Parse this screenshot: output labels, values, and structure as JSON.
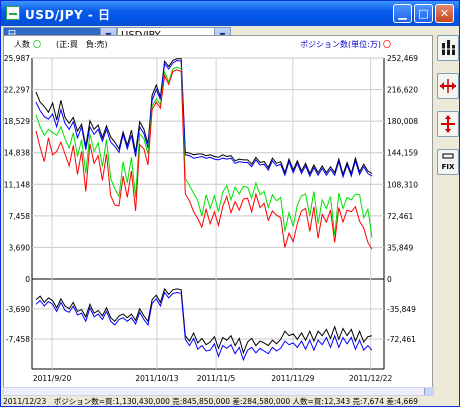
{
  "window": {
    "title": "USD/JPY - 日"
  },
  "toolbar": {
    "left_combo_value": "日",
    "right_combo_value": "USD/JPY"
  },
  "legend": {
    "left_label": "人数",
    "left_marker": "〇",
    "sign_note": "(正:買　負:売)",
    "right_label": "ポジション数(単位:万)",
    "right_marker": "〇"
  },
  "colors": {
    "position_buy": "#000080",
    "position_sell": "#0000ff",
    "people_buy": "#00e000",
    "people_sell": "#ff0000",
    "black_series": "#000000"
  },
  "chart_data": [
    {
      "type": "line",
      "panel": "upper",
      "left_axis_ticks": [
        "25,987",
        "22,297",
        "18,529",
        "14,838",
        "11,148",
        "7,458",
        "3,690",
        "0"
      ],
      "right_axis_ticks": [
        "252,469",
        "216,620",
        "180,008",
        "144,159",
        "108,310",
        "72,461",
        "35,849",
        "0"
      ],
      "left_ylim": [
        0,
        25987
      ],
      "right_ylim": [
        0,
        252469
      ],
      "x_tick_labels": [
        "2011/9/20",
        "2011/10/13",
        "2011/11/5",
        "2011/11/29",
        "2011/12/22"
      ],
      "series": [
        {
          "color_key": "black_series",
          "axis": "left",
          "values": [
            22000,
            20800,
            20300,
            19600,
            20700,
            18700,
            21000,
            19000,
            18300,
            19000,
            17400,
            18200,
            15600,
            18600,
            17600,
            18100,
            16600,
            18000,
            16700,
            16100,
            15300,
            17300,
            15700,
            17500,
            14900,
            18500,
            17600,
            15900,
            21600,
            22800,
            21400,
            25600,
            25000,
            25700,
            25900,
            25900,
            14900,
            14800,
            14600,
            14700,
            14700,
            14500,
            14600,
            14400,
            14300,
            14600,
            14400,
            14500,
            13900,
            14100,
            14000,
            14000,
            13500,
            14300,
            13700,
            13800,
            13100,
            14200,
            13600,
            13800,
            12500,
            14100,
            12800,
            13900,
            12700,
            13600,
            12400,
            13400,
            12500,
            13300,
            12500,
            13200,
            12500,
            14100,
            12300,
            13700,
            12400,
            14200,
            12600,
            13500,
            12700,
            12400
          ]
        },
        {
          "color_key": "position_sell",
          "axis": "left",
          "values": [
            20800,
            19800,
            19100,
            18800,
            19400,
            17900,
            19900,
            18300,
            17600,
            18500,
            16600,
            17900,
            15200,
            17900,
            17000,
            17600,
            16200,
            17600,
            16100,
            15600,
            14900,
            17000,
            15300,
            16900,
            14400,
            17900,
            17100,
            15400,
            21000,
            22300,
            21100,
            25300,
            24700,
            25400,
            25700,
            25600,
            14600,
            14500,
            14200,
            14300,
            14400,
            14200,
            14300,
            14100,
            14000,
            14200,
            14100,
            14200,
            13600,
            13800,
            13700,
            13700,
            13200,
            14000,
            13400,
            13500,
            12800,
            13900,
            13300,
            13500,
            12200,
            13800,
            12500,
            13600,
            12400,
            13300,
            12100,
            13100,
            12200,
            13000,
            12200,
            12900,
            12200,
            13800,
            12000,
            13400,
            12100,
            13900,
            12300,
            13200,
            12400,
            12100
          ]
        },
        {
          "color_key": "people_buy",
          "axis": "left",
          "values": [
            19300,
            17900,
            16900,
            17600,
            17200,
            16900,
            17900,
            16500,
            15400,
            17200,
            14400,
            16400,
            12400,
            17100,
            15000,
            16000,
            13200,
            16400,
            11800,
            10600,
            9700,
            13800,
            11300,
            14300,
            9600,
            17100,
            16500,
            14700,
            20300,
            21200,
            20500,
            24300,
            23200,
            24700,
            24900,
            24700,
            11800,
            11000,
            10100,
            9200,
            7400,
            9900,
            8300,
            9800,
            7900,
            10200,
            11000,
            9300,
            10800,
            10000,
            10900,
            10800,
            9500,
            11300,
            9900,
            10300,
            8400,
            9900,
            9200,
            9600,
            5600,
            7800,
            6200,
            8700,
            9800,
            10000,
            7400,
            10300,
            6500,
            9300,
            8300,
            9700,
            5100,
            10100,
            8300,
            9600,
            9300,
            10000,
            9900,
            7200,
            8200,
            4900
          ]
        },
        {
          "color_key": "people_sell",
          "axis": "left",
          "values": [
            17400,
            15500,
            13800,
            16600,
            14600,
            15000,
            16100,
            14700,
            13300,
            15700,
            12300,
            15000,
            10300,
            15900,
            13600,
            14500,
            11600,
            14700,
            9800,
            8700,
            8600,
            12100,
            9600,
            12700,
            8000,
            15800,
            15300,
            13400,
            19900,
            20800,
            20100,
            23900,
            22900,
            24400,
            24600,
            24400,
            10000,
            9200,
            7900,
            7100,
            6100,
            8200,
            6500,
            7900,
            6300,
            8500,
            9700,
            7800,
            9100,
            8100,
            9400,
            9500,
            7900,
            10000,
            8400,
            8900,
            6900,
            8000,
            7500,
            7200,
            3700,
            5400,
            4400,
            6500,
            8000,
            8300,
            5600,
            8500,
            4800,
            7600,
            6700,
            8100,
            4300,
            8400,
            6700,
            8100,
            7900,
            8500,
            6800,
            6000,
            4300,
            3500
          ]
        }
      ]
    },
    {
      "type": "line",
      "panel": "lower",
      "left_axis_ticks": [
        "0",
        "-3,690",
        "-7,458"
      ],
      "right_axis_ticks": [
        "0",
        "-35,849",
        "-72,461"
      ],
      "left_ylim": [
        -10000,
        0
      ],
      "series": [
        {
          "color_key": "black_series",
          "axis": "left",
          "values": [
            -2300,
            -1900,
            -2600,
            -2100,
            -2400,
            -3200,
            -2200,
            -3000,
            -3300,
            -2600,
            -3600,
            -3400,
            -4200,
            -2800,
            -3800,
            -3500,
            -4100,
            -3200,
            -4300,
            -4700,
            -4100,
            -3900,
            -4300,
            -3900,
            -4600,
            -3300,
            -4100,
            -4700,
            -2300,
            -1800,
            -2600,
            -1100,
            -1700,
            -1200,
            -1100,
            -1200,
            -6300,
            -6900,
            -6000,
            -7100,
            -6600,
            -7300,
            -7000,
            -6400,
            -7700,
            -6500,
            -6800,
            -6300,
            -7400,
            -6600,
            -8200,
            -7000,
            -6600,
            -7400,
            -6900,
            -7100,
            -7400,
            -6800,
            -7200,
            -6700,
            -5800,
            -6300,
            -6100,
            -6700,
            -6000,
            -6800,
            -5800,
            -6900,
            -5800,
            -6300,
            -5600,
            -6600,
            -5300,
            -6700,
            -5500,
            -6300,
            -5600,
            -6900,
            -5800,
            -7000,
            -6400,
            -6300
          ]
        },
        {
          "color_key": "position_sell",
          "axis": "left",
          "values": [
            -2800,
            -2400,
            -3000,
            -2500,
            -2800,
            -3600,
            -2600,
            -3500,
            -3700,
            -3000,
            -4000,
            -3800,
            -4700,
            -3200,
            -4200,
            -3900,
            -4500,
            -3600,
            -4700,
            -5100,
            -4500,
            -4300,
            -4700,
            -4300,
            -5000,
            -3700,
            -4500,
            -5100,
            -2700,
            -2200,
            -3000,
            -1500,
            -2100,
            -1600,
            -1500,
            -1600,
            -6700,
            -7400,
            -6600,
            -7800,
            -7400,
            -8000,
            -7900,
            -7200,
            -8600,
            -7400,
            -7700,
            -7300,
            -8300,
            -7600,
            -9000,
            -7900,
            -7600,
            -8200,
            -7700,
            -8000,
            -8300,
            -7600,
            -8000,
            -7700,
            -6900,
            -7300,
            -7100,
            -7600,
            -6900,
            -7800,
            -6800,
            -7900,
            -6800,
            -7300,
            -6500,
            -7600,
            -6300,
            -7600,
            -6500,
            -7200,
            -6500,
            -7800,
            -6800,
            -7900,
            -7400,
            -7900
          ]
        }
      ]
    }
  ],
  "status_bar": {
    "text": "2011/12/23　ポジション数=買:1,130,430,000 売:845,850,000 差:284,580,000 人数=買:12,343 売:7,674 差:4,669"
  },
  "side_tools": [
    {
      "icon": "chart-bars-icon"
    },
    {
      "icon": "horizontal-expand-icon"
    },
    {
      "icon": "crosshair-icon"
    },
    {
      "icon": "fix-icon",
      "label": "FIX"
    }
  ]
}
